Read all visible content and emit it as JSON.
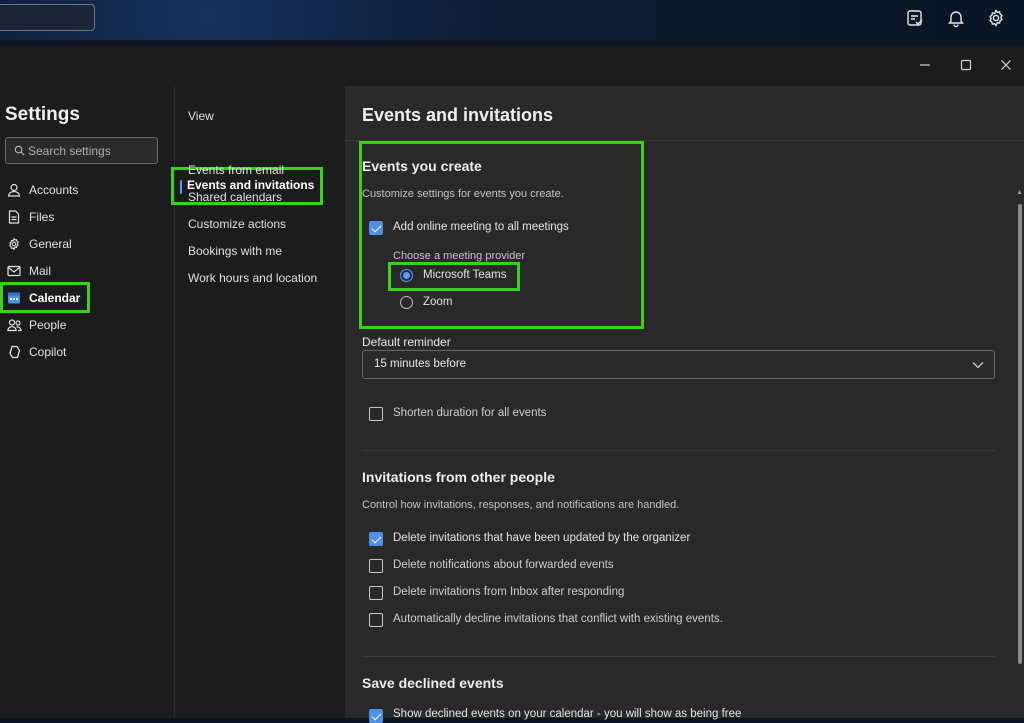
{
  "topbar": {
    "icons": [
      "checklist-icon",
      "bell-icon",
      "gear-icon"
    ]
  },
  "window": {
    "controls": [
      "minimize-icon",
      "maximize-icon",
      "close-icon"
    ]
  },
  "sidebar": {
    "title": "Settings",
    "search_placeholder": "Search settings",
    "items": [
      {
        "label": "Accounts",
        "icon": "person-icon"
      },
      {
        "label": "Files",
        "icon": "file-icon"
      },
      {
        "label": "General",
        "icon": "gear-icon"
      },
      {
        "label": "Mail",
        "icon": "mail-icon"
      },
      {
        "label": "Calendar",
        "icon": "calendar-icon",
        "active": true
      },
      {
        "label": "People",
        "icon": "people-icon"
      },
      {
        "label": "Copilot",
        "icon": "copilot-icon"
      }
    ]
  },
  "subnav": {
    "items": [
      {
        "label": "View"
      },
      {
        "label": "Events and invitations",
        "active": true
      },
      {
        "label": "Events from email"
      },
      {
        "label": "Shared calendars"
      },
      {
        "label": "Customize actions"
      },
      {
        "label": "Bookings with me"
      },
      {
        "label": "Work hours and location"
      }
    ]
  },
  "pane": {
    "title": "Events and invitations",
    "events_you_create": {
      "heading": "Events you create",
      "description": "Customize settings for events you create.",
      "online_meeting": {
        "label": "Add online meeting to all meetings",
        "checked": true
      },
      "provider_label": "Choose a meeting provider",
      "providers": [
        {
          "label": "Microsoft Teams",
          "selected": true
        },
        {
          "label": "Zoom",
          "selected": false
        }
      ],
      "reminder_label": "Default reminder",
      "reminder_value": "15 minutes before",
      "shorten": {
        "label": "Shorten duration for all events",
        "checked": false
      }
    },
    "invitations": {
      "heading": "Invitations from other people",
      "description": "Control how invitations, responses, and notifications are handled.",
      "options": [
        {
          "label": "Delete invitations that have been updated by the organizer",
          "checked": true
        },
        {
          "label": "Delete notifications about forwarded events",
          "checked": false
        },
        {
          "label": "Delete invitations from Inbox after responding",
          "checked": false
        },
        {
          "label": "Automatically decline invitations that conflict with existing events.",
          "checked": false
        }
      ]
    },
    "save_declined": {
      "heading": "Save declined events",
      "options": [
        {
          "label": "Show declined events on your calendar - you will show as being free",
          "checked": true
        }
      ]
    }
  },
  "colors": {
    "accent": "#4f8fe8",
    "highlight": "#3bd11a",
    "pane_bg": "#292929",
    "sidebar_bg": "#1c1c1c"
  }
}
